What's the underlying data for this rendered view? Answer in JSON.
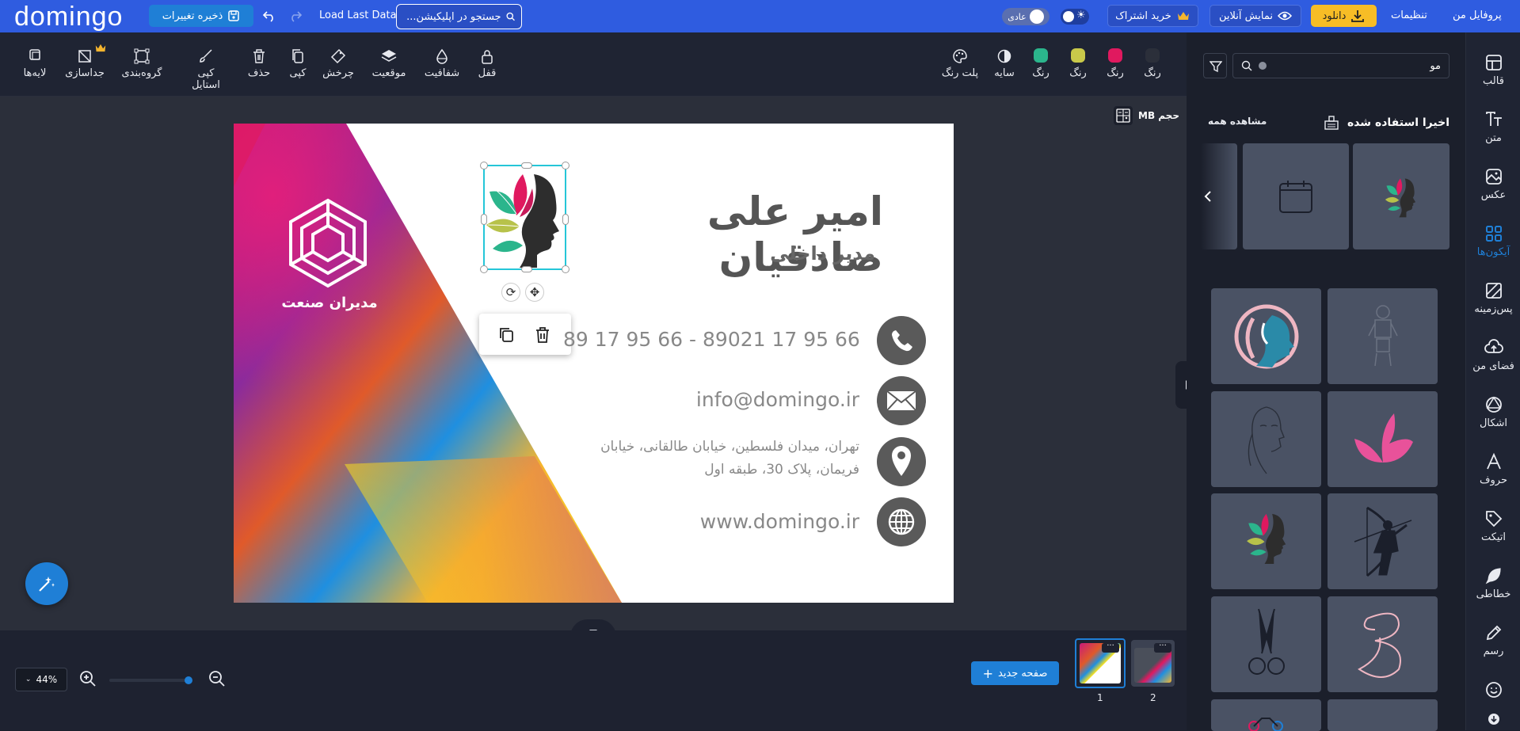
{
  "topbar": {
    "logo": "domingo",
    "save_label": "ذخیره تغییرات",
    "load_label": "Load Last Data",
    "search_placeholder": "جستجو در اپلیکیشن...",
    "mode_label": "عادی",
    "buy_label": "خرید اشتراک",
    "preview_label": "نمایش آنلاین",
    "download_label": "دانلود",
    "settings_label": "تنظیمات",
    "profile_label": "پروفایل من"
  },
  "toolbar": {
    "left_tools": [
      {
        "label": "لایه‌ها",
        "icon": "layers-icon"
      },
      {
        "label": "جداسازی",
        "icon": "ungroup-icon"
      },
      {
        "label": "گروه‌بندی",
        "icon": "group-icon"
      },
      {
        "label": "کپی استایل",
        "icon": "brush-icon"
      },
      {
        "label": "حذف",
        "icon": "trash-icon"
      },
      {
        "label": "کپی",
        "icon": "copy-icon"
      },
      {
        "label": "چرخش",
        "icon": "rotate-icon"
      },
      {
        "label": "موقعیت",
        "icon": "stack-icon"
      },
      {
        "label": "شفافیت",
        "icon": "drop-icon"
      },
      {
        "label": "قفل",
        "icon": "lock-icon"
      }
    ],
    "color_tools": [
      {
        "label": "پلت رنگ",
        "icon": "palette-icon"
      },
      {
        "label": "سایه",
        "icon": "shadow-icon"
      },
      {
        "label": "رنگ",
        "color": "#2bb58c"
      },
      {
        "label": "رنگ",
        "color": "#c9c94a"
      },
      {
        "label": "رنگ",
        "color": "#e0195f"
      },
      {
        "label": "رنگ",
        "color": "#2b2f3a"
      }
    ]
  },
  "canvas": {
    "size_label": "حجم MB",
    "company": "مدیران صنعت",
    "name": "امیر علی صادقیان",
    "title": "مدیر داخلی",
    "phone": "89 17 95 66 - 89021 17 95 66 - 1",
    "email": "info@domingo.ir",
    "address_line1": "تهران، میدان فلسطین، خیابان طالقانی، خیابان",
    "address_line2": "فریمان، پلاک 30، طبقه اول",
    "website": "www.domingo.ir"
  },
  "bottom": {
    "zoom": "44%",
    "new_page_label": "صفحه جدید",
    "pages": [
      "1",
      "2"
    ]
  },
  "panel": {
    "search_value": "مو",
    "recent_title": "اخیرا استفاده شده",
    "view_all": "مشاهده همه"
  },
  "nav": [
    {
      "label": "قالب",
      "icon": "template-icon"
    },
    {
      "label": "متن",
      "icon": "text-icon"
    },
    {
      "label": "عکس",
      "icon": "photo-icon"
    },
    {
      "label": "آیکون‌ها",
      "icon": "icons-icon",
      "active": true
    },
    {
      "label": "پس‌زمینه",
      "icon": "background-icon"
    },
    {
      "label": "فضای من",
      "icon": "upload-icon"
    },
    {
      "label": "اشکال",
      "icon": "shapes-icon"
    },
    {
      "label": "حروف",
      "icon": "letters-icon"
    },
    {
      "label": "اتیکت",
      "icon": "tag-icon"
    },
    {
      "label": "خطاطی",
      "icon": "feather-icon"
    },
    {
      "label": "رسم",
      "icon": "pencil-icon"
    }
  ]
}
